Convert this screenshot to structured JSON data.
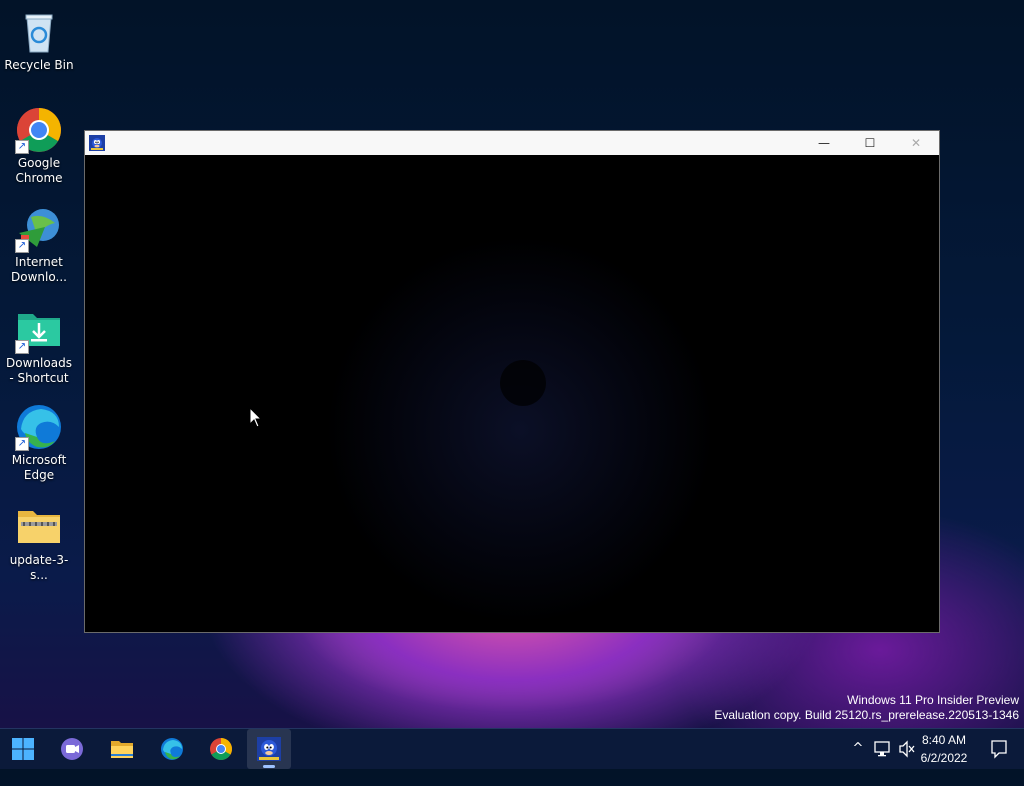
{
  "desktop": {
    "icons": [
      {
        "label": "Recycle Bin",
        "icon": "recycle-bin-icon"
      },
      {
        "label": "Google Chrome",
        "icon": "chrome-icon"
      },
      {
        "label": "Internet Downlo...",
        "icon": "internet-download-manager-icon"
      },
      {
        "label": "Downloads - Shortcut",
        "icon": "downloads-folder-icon"
      },
      {
        "label": "Microsoft Edge",
        "icon": "edge-icon"
      },
      {
        "label": "update-3-s...",
        "icon": "zip-folder-icon"
      }
    ]
  },
  "window": {
    "app_icon": "sonic-icon",
    "minimize_glyph": "—",
    "maximize_glyph": "☐",
    "close_glyph": "✕"
  },
  "watermark": {
    "line1": "Windows 11 Pro Insider Preview",
    "line2": "Evaluation copy. Build 25120.rs_prerelease.220513-1346"
  },
  "taskbar": {
    "items": [
      {
        "name": "start-button",
        "icon": "windows-start-icon"
      },
      {
        "name": "teams-chat",
        "icon": "teams-chat-icon"
      },
      {
        "name": "file-explorer",
        "icon": "file-explorer-icon"
      },
      {
        "name": "edge",
        "icon": "edge-icon"
      },
      {
        "name": "chrome",
        "icon": "chrome-icon"
      },
      {
        "name": "sonic-app",
        "icon": "sonic-icon",
        "active": true
      }
    ],
    "tray": {
      "show_hidden": "^",
      "time": "8:40 AM",
      "date": "6/2/2022"
    }
  }
}
